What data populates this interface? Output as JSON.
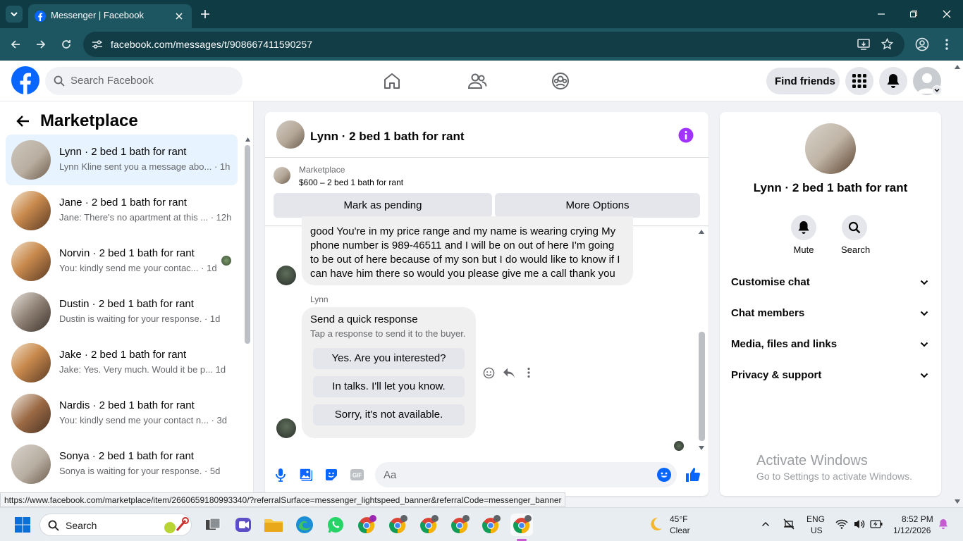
{
  "browser": {
    "tab_title": "Messenger | Facebook",
    "url": "facebook.com/messages/t/908667411590257",
    "status_url": "https://www.facebook.com/marketplace/item/2660659180993340/?referralSurface=messenger_lightspeed_banner&referralCode=messenger_banner"
  },
  "header": {
    "search_placeholder": "Search Facebook",
    "find_friends": "Find friends"
  },
  "left": {
    "title": "Marketplace",
    "conversations": [
      {
        "title": "Lynn · 2 bed 1 bath for rant",
        "preview": "Lynn Kline sent you a message abo...",
        "time": "· 1h"
      },
      {
        "title": "Jane · 2 bed 1 bath for rant",
        "preview": "Jane: There's no apartment at this ...",
        "time": "· 12h"
      },
      {
        "title": "Norvin · 2 bed 1 bath for rant",
        "preview": "You: kindly send me your contac...",
        "time": "· 1d"
      },
      {
        "title": "Dustin · 2 bed 1 bath for rant",
        "preview": "Dustin is waiting for your response.",
        "time": "· 1d"
      },
      {
        "title": "Jake · 2 bed 1 bath for rant",
        "preview": "Jake: Yes. Very much. Would it be p...",
        "time": "1d"
      },
      {
        "title": "Nardis · 2 bed 1 bath for rant",
        "preview": "You: kindly send me your contact n...",
        "time": "· 3d"
      },
      {
        "title": "Sonya · 2 bed 1 bath for rant",
        "preview": "Sonya is waiting for your response.",
        "time": "· 5d"
      }
    ]
  },
  "chat": {
    "title": "Lynn · 2 bed 1 bath for rant",
    "listing_source": "Marketplace",
    "listing": "$600 – 2 bed 1 bath for rant",
    "mark_pending": "Mark as pending",
    "more_options": "More Options",
    "message_lines": [
      "good You're in my price range and my name is wearing crying My",
      "phone number is 989-46511 and I will be on out of here I'm going",
      "to be out of here because of my son but I do would like to know if I",
      "can have him there so would you please give me a call thank you"
    ],
    "sender": "Lynn",
    "quick_title": "Send a quick response",
    "quick_sub": "Tap a response to send it to the buyer.",
    "quick_replies": [
      "Yes. Are you interested?",
      "In talks. I'll let you know.",
      "Sorry, it's not available."
    ],
    "composer_placeholder": "Aa"
  },
  "right": {
    "name": "Lynn · 2 bed 1 bath for rant",
    "mute": "Mute",
    "search": "Search",
    "sections": [
      "Customise chat",
      "Chat members",
      "Media, files and links",
      "Privacy & support"
    ],
    "watermark_title": "Activate Windows",
    "watermark_sub": "Go to Settings to activate Windows."
  },
  "taskbar": {
    "search": "Search",
    "weather_temp": "45°F",
    "weather_desc": "Clear",
    "lang_line1": "ENG",
    "lang_line2": "US",
    "time": "8:52 PM",
    "date": "1/12/2026"
  },
  "colors": {
    "fb_blue": "#0866ff",
    "accent_purple": "#a033ff",
    "hover": "#e7f3ff"
  }
}
